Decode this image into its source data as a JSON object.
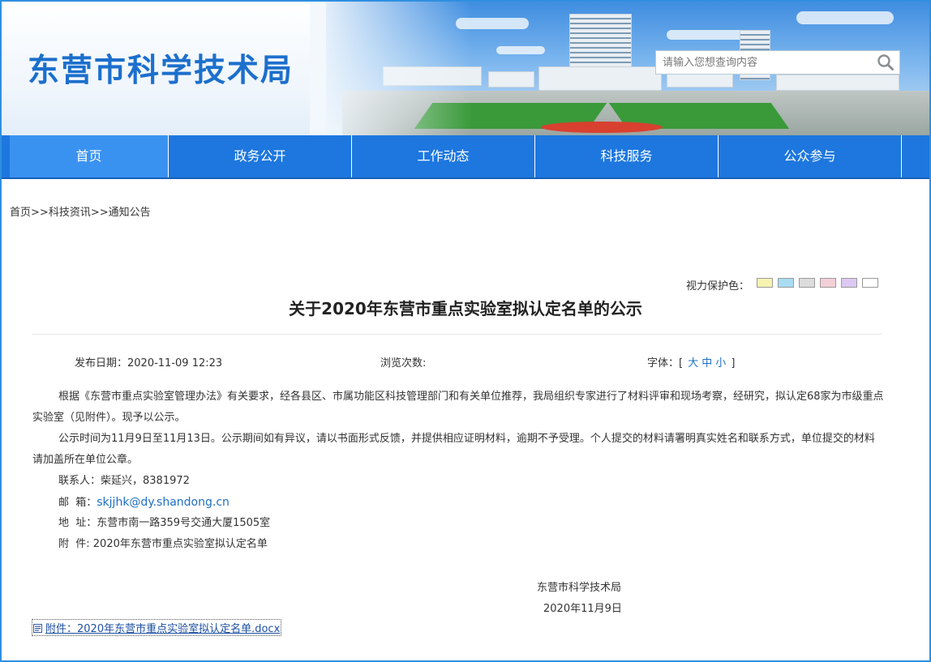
{
  "header": {
    "site_title": "东营市科学技术局",
    "search_placeholder": "请输入您想查询内容"
  },
  "nav": {
    "items": [
      "首页",
      "政务公开",
      "工作动态",
      "科技服务",
      "公众参与"
    ],
    "active": "首页"
  },
  "breadcrumb": {
    "items": [
      "首页",
      "科技资讯",
      "通知公告"
    ],
    "separator": ">>"
  },
  "eye_protection": {
    "label": "视力保护色：",
    "colors": [
      "#f7f3b0",
      "#a9dcf3",
      "#dcdcdc",
      "#f4cfd8",
      "#dcc8f2",
      "#ffffff"
    ]
  },
  "article": {
    "title": "关于2020年东营市重点实验室拟认定名单的公示",
    "publish_label": "发布日期：",
    "publish_date": "2020-11-09 12:23",
    "views_label": "浏览次数:",
    "font_label": "字体：",
    "font_open": "[",
    "font_large": "大",
    "font_medium": "中",
    "font_small": "小",
    "font_close": "]",
    "para1": "根据《东营市重点实验室管理办法》有关要求，经各县区、市属功能区科技管理部门和有关单位推荐，我局组织专家进行了材料评审和现场考察，经研究，拟认定68家为市级重点实验室（见附件）。现予以公示。",
    "para2": "公示时间为11月9日至11月13日。公示期间如有异议，请以书面形式反馈，并提供相应证明材料，逾期不予受理。个人提交的材料请署明真实姓名和联系方式，单位提交的材料请加盖所在单位公章。",
    "contact": "联系人：柴延兴，8381972",
    "email_label": "邮  箱：",
    "email": "skjjhk@dy.shandong.cn",
    "address": "地  址：东营市南一路359号交通大厦1505室",
    "attachment_line": "附  件: 2020年东营市重点实验室拟认定名单",
    "signature": "东营市科学技术局",
    "sign_date": "2020年11月9日",
    "attachment_link": "附件：2020年东营市重点实验室拟认定名单.docx"
  },
  "colors": {
    "nav_blue": "#1d77df",
    "nav_active": "#3a92f0",
    "title_blue": "#1c6fcc",
    "frame_border": "#2f8fe0"
  }
}
